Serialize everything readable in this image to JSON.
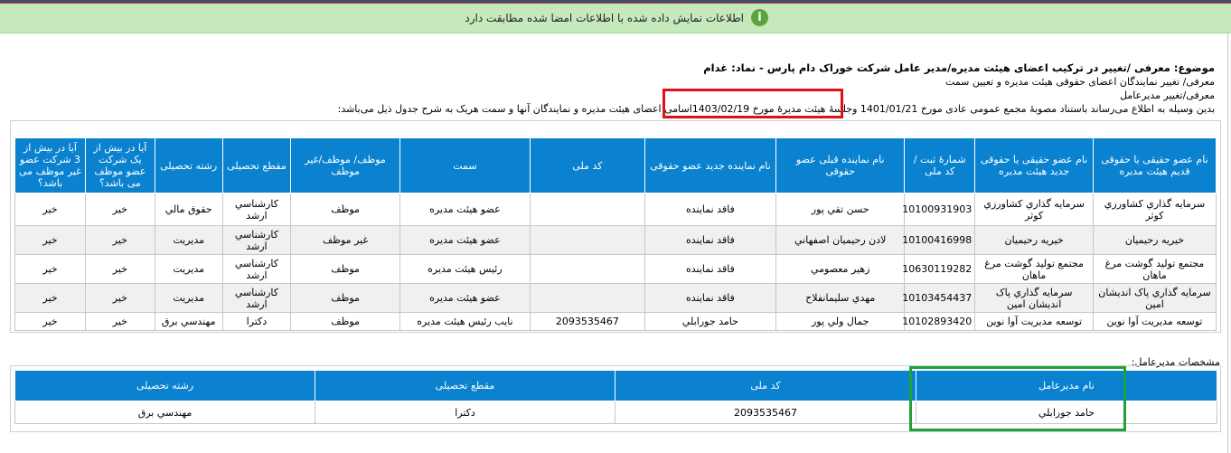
{
  "notice": {
    "text": "اطلاعات نمایش داده شده با اطلاعات امضا شده مطابقت دارد",
    "icon": "info-icon",
    "color": "#5ba33c"
  },
  "subject": {
    "title": "موضوع: معرفی /تغییر در ترکیب اعضای هیئت مدیره/مدیر عامل شرکت خوراک دام پارس - نماد: غدام",
    "line1": "معرفی/ تغییر نمایندگان اعضای حقوقی هیئت مدیره و تعیین سمت",
    "line2": "معرفی/تغییر مدیرعامل",
    "line3_part1": "بدین وسیله به اطلاع می‌رساند باستناد مصوبهٔ مجمع عمومی عادی مورخ",
    "agm_date": "1401/01/21",
    "line3_part2": "وجلسهٔ هیئت مدیرهٔ مورخ",
    "board_date": "1403/02/19",
    "line3_part3": "اسامی اعضای هیئت مدیره و نمایندگان آنها و سمت هریک به شرح جدول ذیل می‌باشد:"
  },
  "board_table": {
    "headers": {
      "old_member": "نام عضو حقیقی یا حقوقی قدیم هیئت مدیره",
      "new_member": "نام عضو حقیقی یا حقوقی جدید هیئت مدیره",
      "reg_no": "شمارهٔ ثبت / کد ملی",
      "prev_rep": "نام نماینده قبلی عضو حقوقی",
      "new_rep": "نام نماینده جدید عضو حقوقی",
      "national_id": "کد ملی",
      "position": "سمت",
      "duty": "موظف/ موظف/غیر موظف",
      "degree": "مقطع تحصیلی",
      "field": "رشته تحصیلی",
      "q1": "آیا در بیش از یک شرکت عضو موظف می باشد؟",
      "q2": "آیا در بیش از 3 شرکت عضو غیر موظف می باشد؟"
    },
    "rows": [
      {
        "old_member": "سرمایه گذاري کشاورزي کوثر",
        "new_member": "سرمايه گذاري كشاورزي كوثر",
        "reg_no": "10100931903",
        "prev_rep": "حسن تقي پور",
        "new_rep": "فاقد نماينده",
        "national_id": "",
        "position": "عضو هيئت مديره",
        "duty": "موظف",
        "degree": "كارشناسي ارشد",
        "field": "حقوق مالي",
        "q1": "خير",
        "q2": "خير"
      },
      {
        "old_member": "خيريه رحيميان",
        "new_member": "خيريه رحيميان",
        "reg_no": "10100416998",
        "prev_rep": "لادن رحيميان اصفهاني",
        "new_rep": "فاقد نماينده",
        "national_id": "",
        "position": "عضو هيئت مديره",
        "duty": "غير موظف",
        "degree": "كارشناسي ارشد",
        "field": "مديريت",
        "q1": "خير",
        "q2": "خير"
      },
      {
        "old_member": "مجتمع توليد گوشت مرغ ماهان",
        "new_member": "مجتمع توليد گوشت مرغ ماهان",
        "reg_no": "10630119282",
        "prev_rep": "زهير معصومي",
        "new_rep": "فاقد نماينده",
        "national_id": "",
        "position": "رئيس هيئت مديره",
        "duty": "موظف",
        "degree": "كارشناسي ارشد",
        "field": "مديريت",
        "q1": "خير",
        "q2": "خير"
      },
      {
        "old_member": "سرمايه گذاري پاک انديشان امين",
        "new_member": "سرمايه گذاري پاک انديشان امين",
        "reg_no": "10103454437",
        "prev_rep": "مهدي سليمانفلاح",
        "new_rep": "فاقد نماينده",
        "national_id": "",
        "position": "عضو هيئت مديره",
        "duty": "موظف",
        "degree": "كارشناسي ارشد",
        "field": "مديريت",
        "q1": "خير",
        "q2": "خير"
      },
      {
        "old_member": "توسعه مديريت آوا نوين",
        "new_member": "توسعه مديريت آوا نوين",
        "reg_no": "10102893420",
        "prev_rep": "جمال ولي پور",
        "new_rep": "حامد جورابلي",
        "national_id": "2093535467",
        "position": "نايب رئيس هيئت مديره",
        "duty": "موظف",
        "degree": "دكترا",
        "field": "مهندسي برق",
        "q1": "خير",
        "q2": "خير"
      }
    ]
  },
  "manager": {
    "label": "مشخصات مدیرعامل:",
    "headers": {
      "name": "نام مدیرعامل",
      "national_id": "کد ملی",
      "degree": "مقطع تحصیلی",
      "field": "رشته تحصیلی"
    },
    "name": "حامد جورابلي",
    "national_id": "2093535467",
    "degree": "دكترا",
    "field": "مهندسي برق"
  },
  "colors": {
    "header_bg": "#0a82cf",
    "notice_bg": "#c5e8bc",
    "highlight_red": "#e0101b",
    "highlight_green": "#1ea33a"
  }
}
